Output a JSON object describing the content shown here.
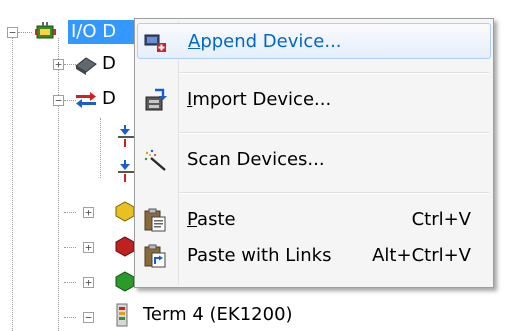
{
  "tree": {
    "root": {
      "label": "I/O D",
      "icon": "io-devices-icon"
    },
    "device_1": {
      "label": "D",
      "icon": "device-icon"
    },
    "device_2": {
      "label": "D",
      "icon": "ethercat-device-icon"
    },
    "term": {
      "label": "Term 4 (EK1200)",
      "icon": "terminal-icon"
    }
  },
  "context_menu": {
    "items": [
      {
        "label": "Append Device...",
        "mnemonic": "A",
        "shortcut": "",
        "icon": "append-device-icon"
      },
      {
        "label": "Import Device...",
        "mnemonic": "I",
        "shortcut": "",
        "icon": "import-device-icon"
      },
      {
        "label": "Scan Devices...",
        "mnemonic": "",
        "shortcut": "",
        "icon": "scan-devices-icon"
      },
      {
        "label": "Paste",
        "mnemonic": "P",
        "shortcut": "Ctrl+V",
        "icon": "paste-icon"
      },
      {
        "label": "Paste with Links",
        "mnemonic": "",
        "shortcut": "Alt+Ctrl+V",
        "icon": "paste-links-icon"
      }
    ]
  },
  "colors": {
    "selection": "#3399ff",
    "menu_background": "#f5f5f5",
    "menu_highlight_border": "#aecff7",
    "link_text": "#0066cc"
  }
}
